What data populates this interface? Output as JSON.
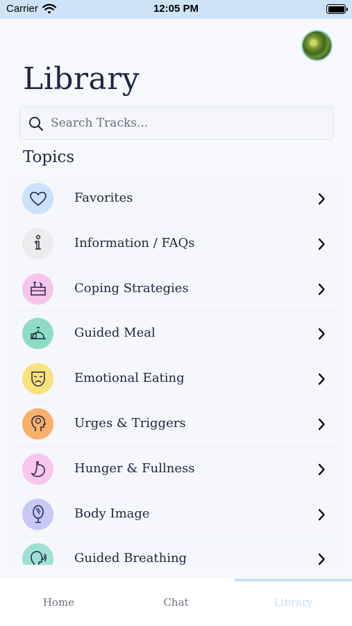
{
  "status_bar": {
    "carrier": "Carrier",
    "time": "12:05 PM"
  },
  "page": {
    "title": "Library"
  },
  "search": {
    "placeholder": "Search Tracks..."
  },
  "section": {
    "heading": "Topics"
  },
  "topics": [
    {
      "label": "Favorites",
      "icon": "heart-icon",
      "color": "#c9e1fa"
    },
    {
      "label": "Information / FAQs",
      "icon": "info-icon",
      "color": "#ececec"
    },
    {
      "label": "Coping Strategies",
      "icon": "toolbox-icon",
      "color": "#f7c4ec"
    },
    {
      "label": "Guided Meal",
      "icon": "meal-icon",
      "color": "#8fdcc4"
    },
    {
      "label": "Emotional Eating",
      "icon": "sad-mask-icon",
      "color": "#f9e27a"
    },
    {
      "label": "Urges & Triggers",
      "icon": "head-brain-icon",
      "color": "#f8b06b"
    },
    {
      "label": "Hunger & Fullness",
      "icon": "stomach-icon",
      "color": "#f8c6ee"
    },
    {
      "label": "Body Image",
      "icon": "mirror-icon",
      "color": "#c7c8f6"
    },
    {
      "label": "Guided Breathing",
      "icon": "breathing-head-icon",
      "color": "#9fe0d4"
    }
  ],
  "tabs": [
    {
      "label": "Home",
      "active": false
    },
    {
      "label": "Chat",
      "active": false
    },
    {
      "label": "Library",
      "active": true
    }
  ],
  "colors": {
    "status_bar": "#cfe3f7",
    "active_tab": "#c6def3",
    "text": "#1e2640"
  }
}
